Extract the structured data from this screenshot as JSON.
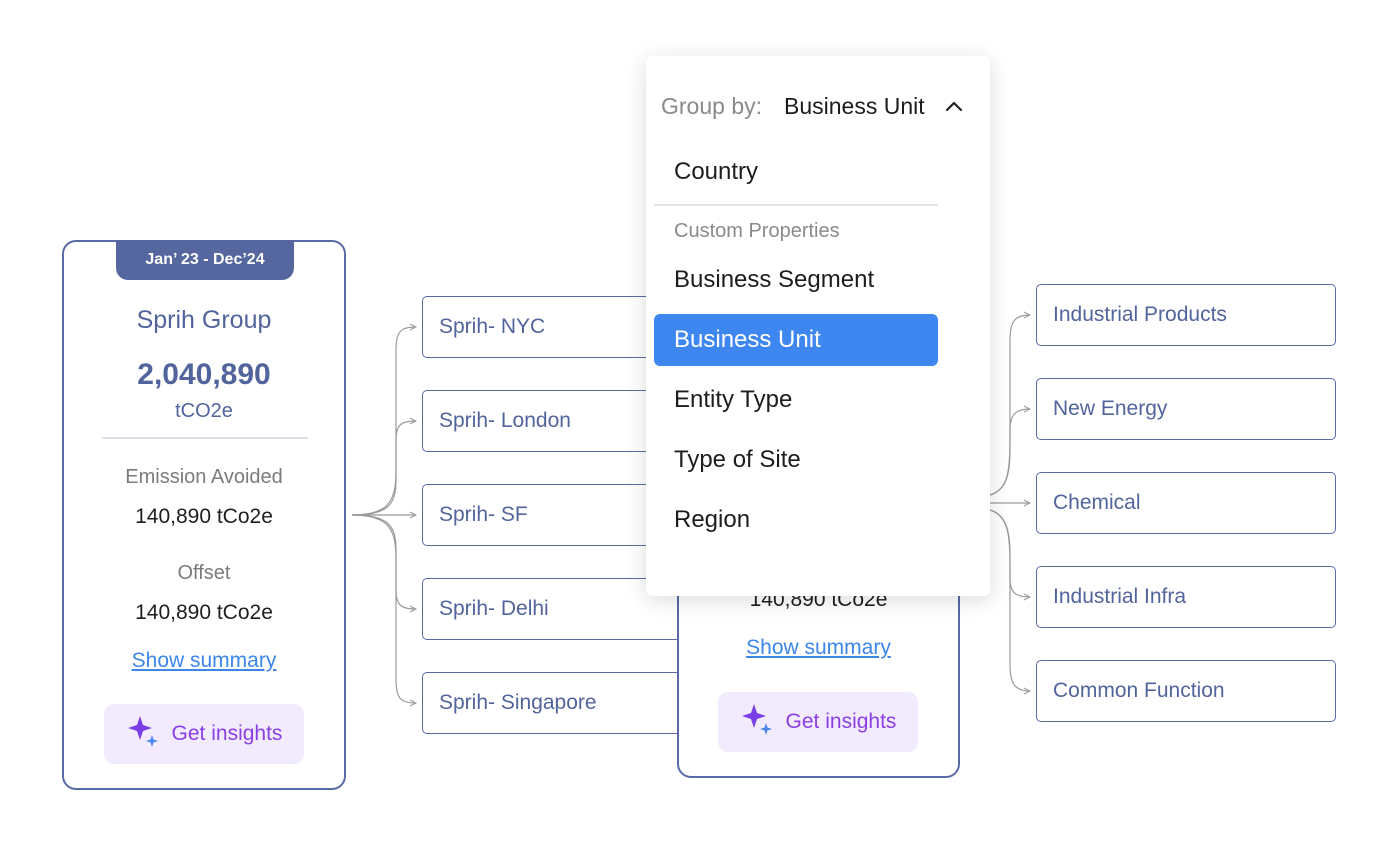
{
  "left_card": {
    "date_range": "Jan’ 23 - Dec’24",
    "entity_name": "Sprih Group",
    "total_value": "2,040,890",
    "total_unit": "tCO2e",
    "emission_avoided_label": "Emission Avoided",
    "emission_avoided_value": "140,890 tCo2e",
    "offset_label": "Offset",
    "offset_value": "140,890 tCo2e",
    "show_summary": "Show summary",
    "get_insights": "Get insights"
  },
  "locations": [
    "Sprih- NYC",
    "Sprih- London",
    "Sprih- SF",
    "Sprih- Delhi",
    "Sprih- Singapore"
  ],
  "middle_card": {
    "offset_value": "140,890 tCo2e",
    "show_summary": "Show summary",
    "get_insights": "Get insights"
  },
  "business_units": [
    "Industrial Products",
    "New Energy",
    "Chemical",
    "Industrial Infra",
    "Common Function"
  ],
  "group_by": {
    "label": "Group by:",
    "selected": "Business Unit",
    "options_top": [
      "Country"
    ],
    "custom_header": "Custom Properties",
    "custom_options": [
      "Business Segment",
      "Business Unit",
      "Entity Type",
      "Type of Site",
      "Region"
    ]
  },
  "icons": {
    "sparkle": "sparkle-icon",
    "chevron": "chevron-up-icon"
  },
  "colors": {
    "primary": "#52649c",
    "accent": "#3f87f0",
    "insight_bg": "#f1ebfd",
    "insight_text": "#8b3ee6"
  }
}
